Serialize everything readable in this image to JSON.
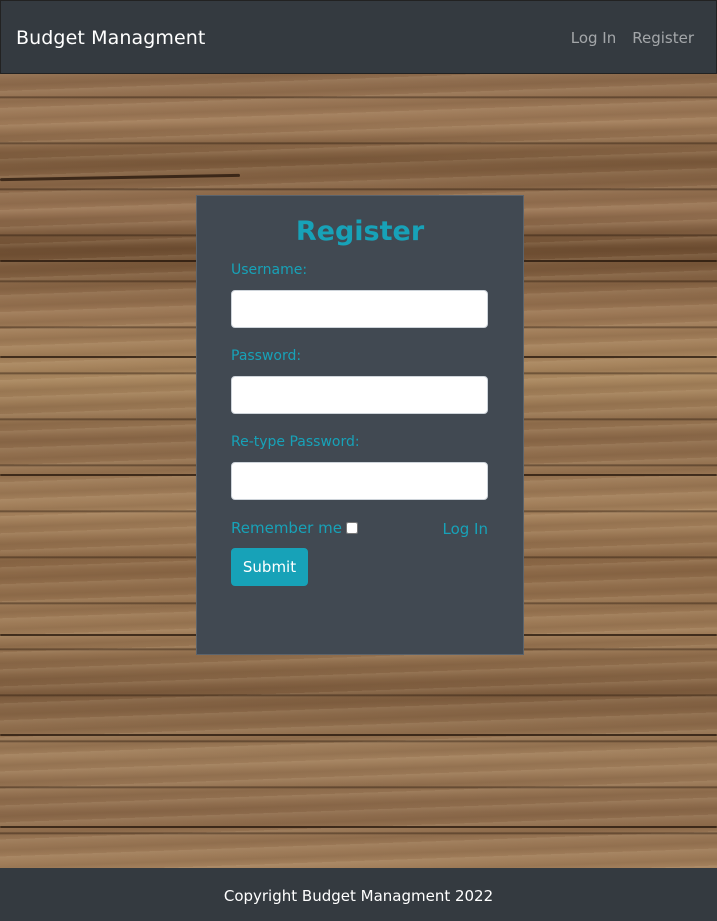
{
  "navbar": {
    "brand": "Budget Managment",
    "links": [
      "Log In",
      "Register"
    ]
  },
  "form": {
    "title": "Register",
    "username_label": "Username:",
    "username_value": "",
    "password_label": "Password:",
    "password_value": "",
    "retype_label": "Re-type Password:",
    "retype_value": "",
    "remember_label": "Remember me",
    "remember_checked": false,
    "login_link": "Log In",
    "submit_label": "Submit"
  },
  "footer": {
    "text": "Copyright Budget Managment 2022"
  },
  "colors": {
    "navbar": "#343a40",
    "card": "#414952",
    "accent": "#17a2b8",
    "footer": "#343a40"
  }
}
